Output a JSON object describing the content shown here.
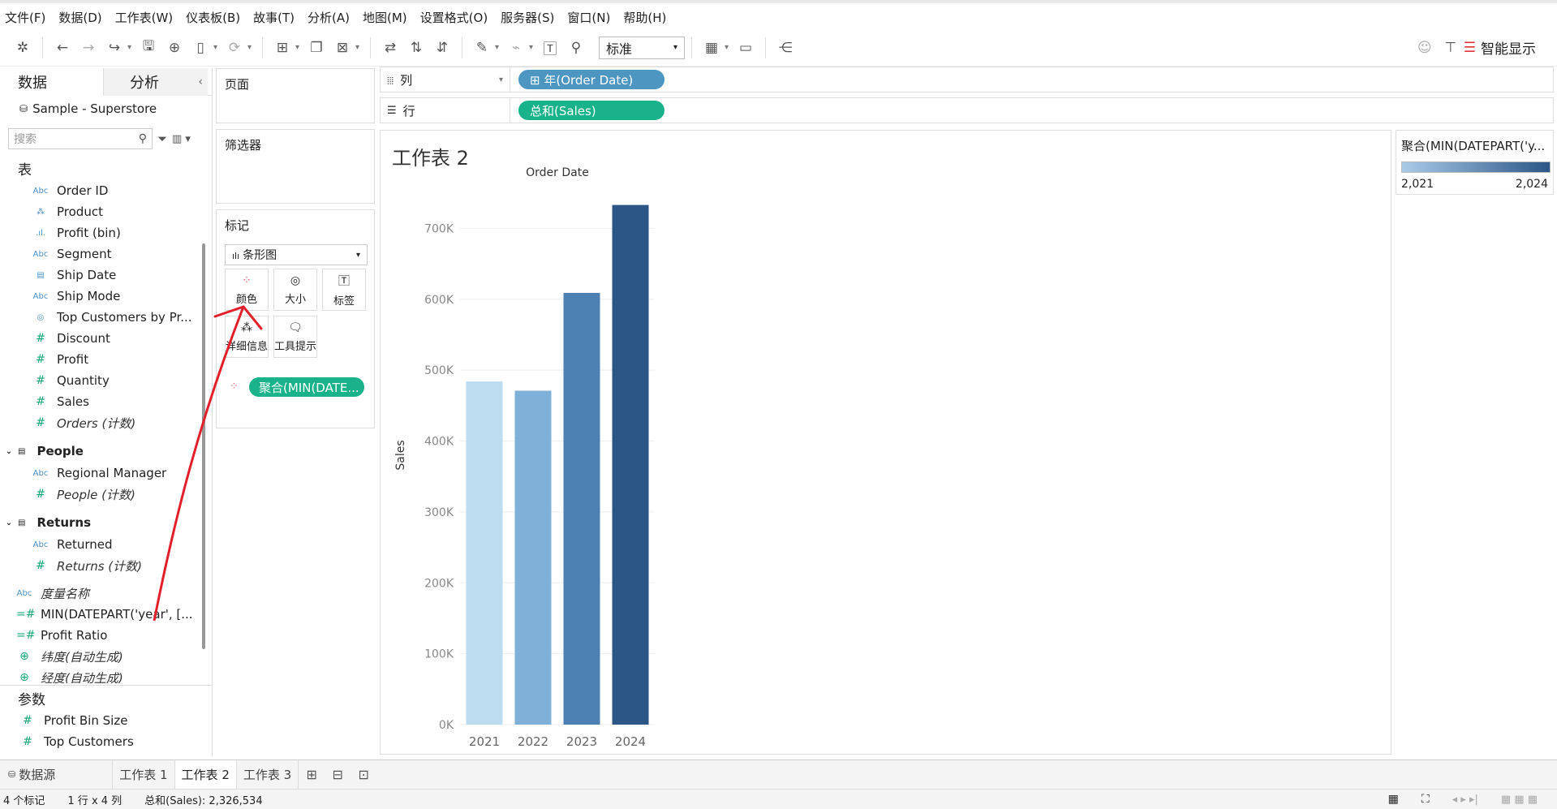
{
  "menu": [
    "文件(F)",
    "数据(D)",
    "工作表(W)",
    "仪表板(B)",
    "故事(T)",
    "分析(A)",
    "地图(M)",
    "设置格式(O)",
    "服务器(S)",
    "窗口(N)",
    "帮助(H)"
  ],
  "toolbar": {
    "fit_select": "标准",
    "smart_show": "智能显示"
  },
  "datapane": {
    "tab_data": "数据",
    "tab_analysis": "分析",
    "datasource": "Sample - Superstore",
    "search_placeholder": "搜索",
    "tables_header": "表",
    "fields": [
      {
        "name": "Order ID",
        "kind": "dim",
        "icon": "Abc"
      },
      {
        "name": "Product",
        "kind": "dim",
        "icon": "hierarchy"
      },
      {
        "name": "Profit (bin)",
        "kind": "dim",
        "icon": "bin"
      },
      {
        "name": "Segment",
        "kind": "dim",
        "icon": "Abc"
      },
      {
        "name": "Ship Date",
        "kind": "dim",
        "icon": "date"
      },
      {
        "name": "Ship Mode",
        "kind": "dim",
        "icon": "Abc"
      },
      {
        "name": "Top Customers by Pr...",
        "kind": "dim",
        "icon": "set"
      },
      {
        "name": "Discount",
        "kind": "mea",
        "icon": "#"
      },
      {
        "name": "Profit",
        "kind": "mea",
        "icon": "#"
      },
      {
        "name": "Quantity",
        "kind": "mea",
        "icon": "#"
      },
      {
        "name": "Sales",
        "kind": "mea",
        "icon": "#"
      },
      {
        "name": "Orders (计数)",
        "kind": "mea",
        "icon": "#",
        "italic": true
      }
    ],
    "people_group": "People",
    "people_fields": [
      {
        "name": "Regional Manager",
        "kind": "dim",
        "icon": "Abc"
      },
      {
        "name": "People (计数)",
        "kind": "mea",
        "icon": "#",
        "italic": true
      }
    ],
    "returns_group": "Returns",
    "returns_fields": [
      {
        "name": "Returned",
        "kind": "dim",
        "icon": "Abc"
      },
      {
        "name": "Returns (计数)",
        "kind": "mea",
        "icon": "#",
        "italic": true
      }
    ],
    "loose_fields": [
      {
        "name": "度量名称",
        "kind": "dim",
        "icon": "Abc",
        "italic": true
      },
      {
        "name": "MIN(DATEPART('year', [...",
        "kind": "mea",
        "icon": "=#"
      },
      {
        "name": "Profit Ratio",
        "kind": "mea",
        "icon": "=#"
      },
      {
        "name": "纬度(自动生成)",
        "kind": "mea",
        "icon": "globe",
        "italic": true
      },
      {
        "name": "经度(自动生成)",
        "kind": "mea",
        "icon": "globe",
        "italic": true
      }
    ],
    "params_header": "参数",
    "params": [
      {
        "name": "Profit Bin Size",
        "icon": "#"
      },
      {
        "name": "Top Customers",
        "icon": "#"
      }
    ]
  },
  "shelves": {
    "pages": "页面",
    "filters": "筛选器",
    "marks": "标记",
    "mark_type": "条形图",
    "btn_color": "颜色",
    "btn_size": "大小",
    "btn_label": "标签",
    "btn_detail": "详细信息",
    "btn_tooltip": "工具提示",
    "color_pill": "聚合(MIN(DATE...",
    "columns_label": "列",
    "rows_label": "行",
    "columns_pill": "⊞ 年(Order Date)",
    "rows_pill": "总和(Sales)"
  },
  "viz": {
    "sheet_title": "工作表 2"
  },
  "legend": {
    "title": "聚合(MIN(DATEPART('y...",
    "min": "2,021",
    "max": "2,024"
  },
  "chart_data": {
    "type": "bar",
    "title": "Order Date",
    "xlabel": "",
    "ylabel": "Sales",
    "categories": [
      "2021",
      "2022",
      "2023",
      "2024"
    ],
    "values": [
      484000,
      471000,
      609000,
      733000
    ],
    "colors": [
      "#bcdcef",
      "#7fb0d8",
      "#4d80b3",
      "#2b5686"
    ],
    "ylim": [
      0,
      760000
    ],
    "yticks": [
      0,
      100000,
      200000,
      300000,
      400000,
      500000,
      600000,
      700000
    ],
    "ytick_labels": [
      "0K",
      "100K",
      "200K",
      "300K",
      "400K",
      "500K",
      "600K",
      "700K"
    ],
    "grid": true
  },
  "sheets": {
    "datasource_tab": "数据源",
    "tabs": [
      "工作表 1",
      "工作表 2",
      "工作表 3"
    ],
    "active": 1
  },
  "status": {
    "marks": "4 个标记",
    "dims": "1 行 x 4 列",
    "sum": "总和(Sales): 2,326,534"
  },
  "colors": {
    "accent_blue": "#4b8fc4",
    "pill_green": "#1ab28a",
    "pill_blue": "#4e96c2",
    "annotation_red": "#e0202a"
  }
}
